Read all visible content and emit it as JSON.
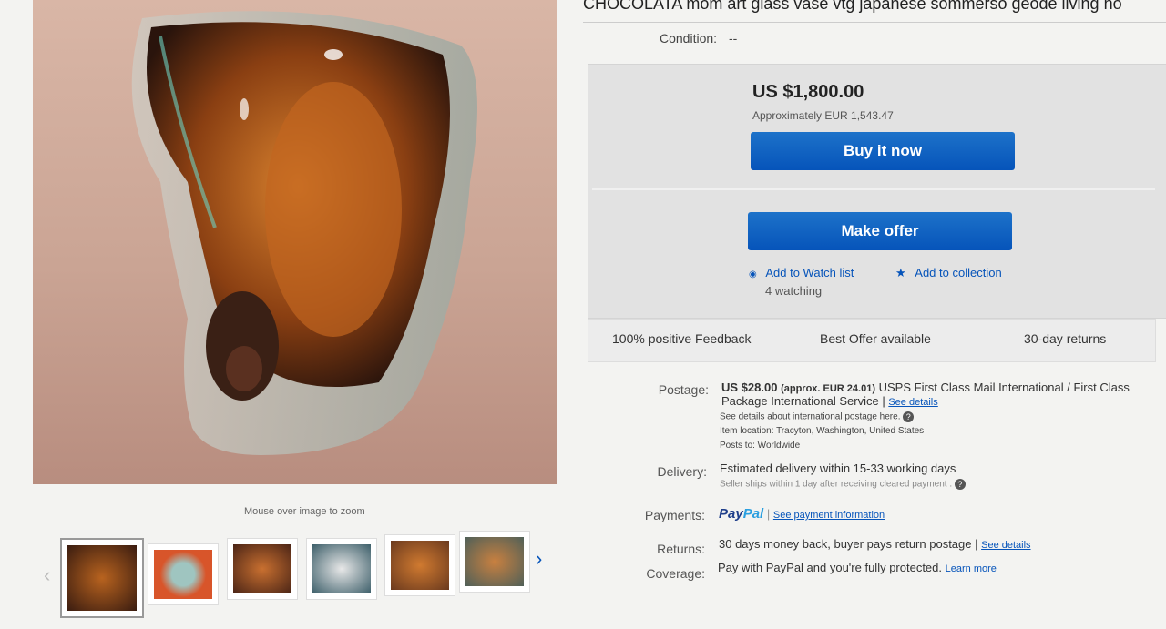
{
  "listing": {
    "title": "CHOCOLATA mom art glass vase vtg japanese sommerso geode living ho",
    "condition_label": "Condition:",
    "condition_value": "--"
  },
  "gallery": {
    "zoom_hint": "Mouse over image to zoom",
    "prev_arrow": "‹",
    "next_arrow": "›"
  },
  "buy_box": {
    "price": "US $1,800.00",
    "approx": "Approximately EUR 1,543.47",
    "buy_now_label": "Buy it now",
    "make_offer_label": "Make offer",
    "watch_label": "Add to Watch list",
    "collection_label": "Add to collection",
    "watching": "4 watching"
  },
  "features": [
    "100% positive Feedback",
    "Best Offer available",
    "30-day returns"
  ],
  "shipping": {
    "postage_label": "Postage:",
    "postage_price": "US $28.00",
    "postage_approx": "(approx. EUR 24.01)",
    "postage_service": "USPS First Class Mail International / First Class",
    "postage_service2": "Package International Service |",
    "see_details": "See details",
    "intl_note": "See details about international postage here.",
    "item_location": "Item location:  Tracyton, Washington, United States",
    "posts_to": "Posts to:  Worldwide",
    "delivery_label": "Delivery:",
    "delivery_value": "Estimated delivery within 15-33 working days",
    "delivery_note": "Seller ships within 1 day after receiving cleared payment .",
    "payments_label": "Payments:",
    "paypal_1": "Pay",
    "paypal_2": "Pal",
    "payment_info": "See payment information",
    "returns_label": "Returns:",
    "returns_value": "30 days money back, buyer pays return postage |",
    "returns_details": "See details",
    "coverage_label": "Coverage:",
    "coverage_value": "Pay with PayPal and you're fully protected.",
    "learn_more": "Learn more"
  },
  "colors": {
    "accent": "#0654ba",
    "buybox": "#e2e2e2"
  }
}
